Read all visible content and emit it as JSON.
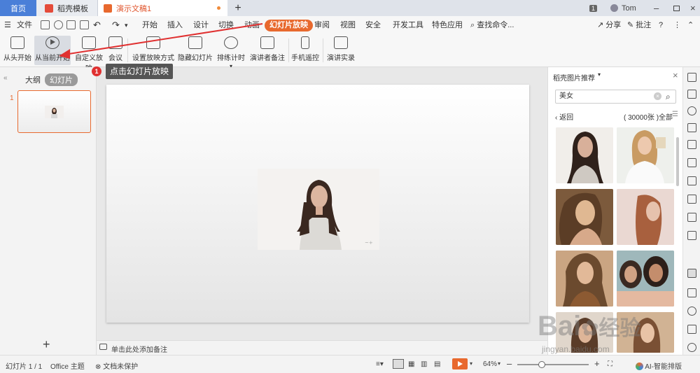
{
  "titlebar": {
    "home_tab": "首页",
    "tab1": "稻壳模板",
    "tab2": "演示文稿1",
    "add_tab": "+",
    "page_badge": "1",
    "user_name": "Tom"
  },
  "menubar": {
    "file": "文件",
    "items": [
      "开始",
      "插入",
      "设计",
      "切换",
      "动画",
      "幻灯片放映",
      "审阅",
      "视图",
      "安全",
      "开发工具",
      "特色应用"
    ],
    "active": "幻灯片放映",
    "search": "查找命令...",
    "share": "分享",
    "comment": "批注"
  },
  "ribbon": {
    "buttons": [
      "从头开始",
      "从当前开始",
      "自定义放映",
      "会议",
      "设置放映方式",
      "隐藏幻灯片",
      "排练计时",
      "演讲者备注",
      "手机遥控",
      "演讲实录"
    ]
  },
  "leftpanel": {
    "outline_tab": "大纲",
    "slides_tab": "幻灯片",
    "slide_number": "1",
    "add_slide": "+"
  },
  "tooltip": {
    "badge": "1",
    "text": "点击幻灯片放映"
  },
  "notes": {
    "placeholder": "单击此处添加备注"
  },
  "rightpanel": {
    "title": "稻壳图片推荐",
    "search_value": "美女",
    "back": "返回",
    "count": "( 30000张 )",
    "filter": "全部"
  },
  "statusbar": {
    "slide_info": "幻灯片 1 / 1",
    "theme": "Office 主题",
    "protect": "文档未保护",
    "zoom": "64%",
    "zoom_level": 0.34,
    "ai": "AI-智能排版"
  },
  "colors": {
    "accent": "#e8692e",
    "home_tab": "#4a7fd8",
    "tooltip_bg": "#555555",
    "badge": "#e03131"
  },
  "watermark": {
    "brand": "Bai",
    "brand2": "经验",
    "url": "jingyan.baidu.com"
  }
}
